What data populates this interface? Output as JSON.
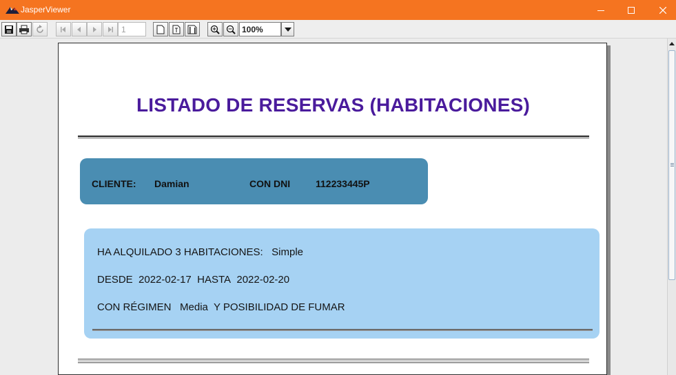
{
  "window": {
    "title": "JasperViewer"
  },
  "toolbar": {
    "page_number": "1",
    "zoom": "100%"
  },
  "report": {
    "title": "LISTADO DE RESERVAS (HABITACIONES)",
    "client_label": "CLIENTE:",
    "client_name": "Damian",
    "dni_label": "CON DNI",
    "dni_value": "112233445P",
    "rooms_text": "HA ALQUILADO 3 HABITACIONES:",
    "room_type": "Simple",
    "from_label": "DESDE",
    "from_date": "2022-02-17",
    "to_label": "HASTA",
    "to_date": "2022-02-20",
    "regime_label": "CON RÉGIMEN",
    "regime_value": "Media",
    "smoking_text": "Y POSIBILIDAD DE FUMAR"
  },
  "colors": {
    "titlebar": "#f57420",
    "title_text": "#4a1b9c",
    "client_box": "#4a8db2",
    "detail_box": "#a6d2f3"
  }
}
